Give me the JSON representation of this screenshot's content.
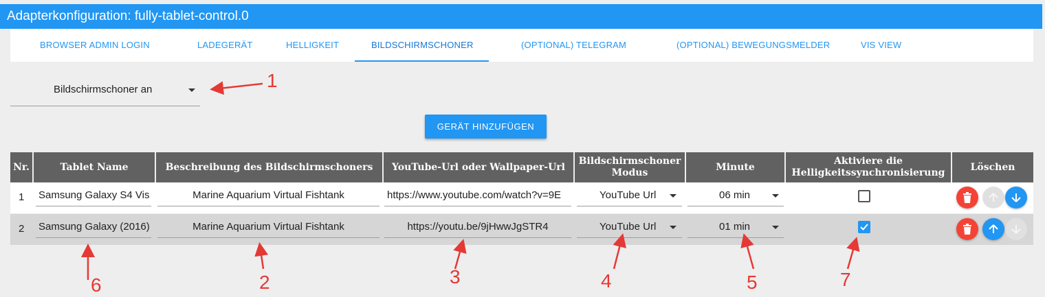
{
  "window": {
    "title": "Adapterkonfiguration: fully-tablet-control.0"
  },
  "tabs": [
    {
      "label": "BROWSER ADMIN LOGIN"
    },
    {
      "label": "LADEGERÄT"
    },
    {
      "label": "HELLIGKEIT"
    },
    {
      "label": "BILDSCHIRMSCHONER",
      "active": true
    },
    {
      "label": "(OPTIONAL) TELEGRAM"
    },
    {
      "label": "(OPTIONAL) BEWEGUNGSMELDER"
    },
    {
      "label": "VIS VIEW"
    }
  ],
  "screensaver_select": {
    "value": "Bildschirmschoner an"
  },
  "add_button": {
    "label": "GERÄT HINZUFÜGEN"
  },
  "table": {
    "headers": {
      "nr": "Nr.",
      "tablet_name": "Tablet Name",
      "description": "Beschreibung des Bildschirmschoners",
      "url": "YouTube-Url oder Wallpaper-Url",
      "mode_line1": "Bildschirmschoner",
      "mode_line2": "Modus",
      "minute": "Minute",
      "sync_line1": "Aktiviere die",
      "sync_line2": "Helligkeitssynchronisierung",
      "delete": "Löschen"
    },
    "rows": [
      {
        "nr": "1",
        "tablet_name": "Samsung Galaxy S4 Vis",
        "description": "Marine Aquarium Virtual Fishtank",
        "url": "https://www.youtube.com/watch?v=9E",
        "mode": "YouTube Url",
        "minute": "06 min",
        "sync_checked": false
      },
      {
        "nr": "2",
        "tablet_name": "Samsung Galaxy (2016)",
        "description": "Marine Aquarium Virtual Fishtank",
        "url": "https://youtu.be/9jHwwJgSTR4",
        "mode": "YouTube Url",
        "minute": "01 min",
        "sync_checked": true
      }
    ]
  },
  "annotations": {
    "a1": "1",
    "a2": "2",
    "a3": "3",
    "a4": "4",
    "a5": "5",
    "a6": "6",
    "a7": "7"
  },
  "colors": {
    "primary": "#2196f3",
    "header_bg": "#616161",
    "delete": "#f44336",
    "annotation": "#e53935"
  }
}
